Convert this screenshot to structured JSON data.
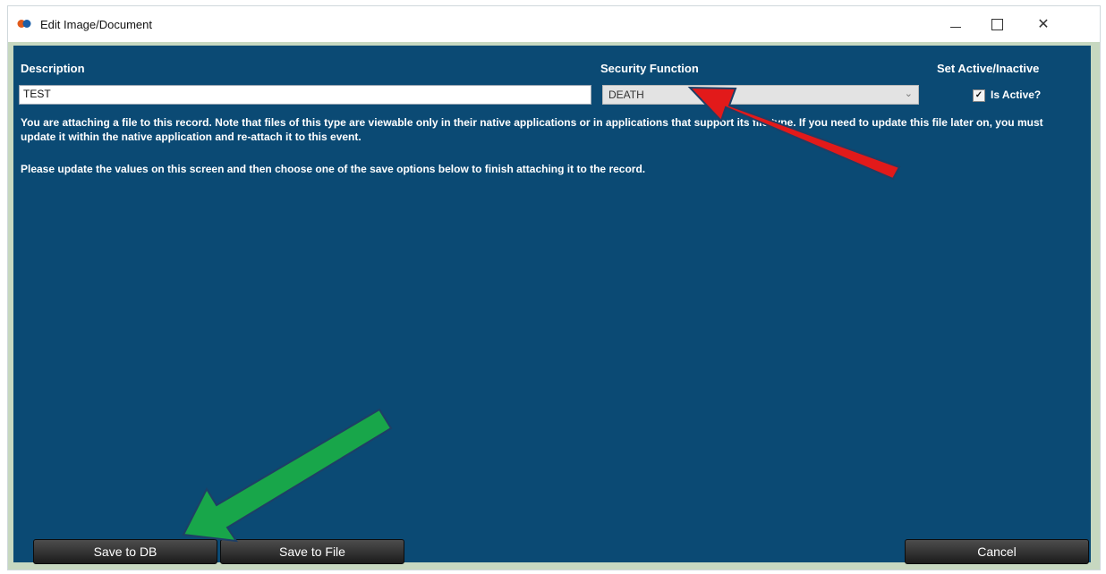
{
  "window": {
    "title": "Edit Image/Document",
    "controls": {
      "minimize": "minimize",
      "maximize": "maximize",
      "close": "close"
    }
  },
  "form": {
    "description_label": "Description",
    "description_value": "TEST",
    "security_label": "Security Function",
    "security_value": "DEATH",
    "active_label": "Set Active/Inactive",
    "is_active_label": "Is Active?",
    "is_active_checked": true
  },
  "notes": {
    "line1": "You are attaching a file to this record.  Note that files of this type are viewable only in their native applications or in applications that support its file type.  If you need to update this file later on, you must update it within the native application and re-attach it to this event.",
    "line2": "Please update the values on this screen and then choose one of the save options below to finish attaching it to the record."
  },
  "buttons": {
    "save_db": "Save to DB",
    "save_file": "Save to File",
    "cancel": "Cancel"
  },
  "colors": {
    "panel": "#0b4a74",
    "arrow_red": "#e21a1a",
    "arrow_green": "#18a64a"
  },
  "icons": {
    "app": "app-logo-icon",
    "checkbox_mark": "checkmark-icon",
    "dropdown": "chevron-down-icon"
  }
}
